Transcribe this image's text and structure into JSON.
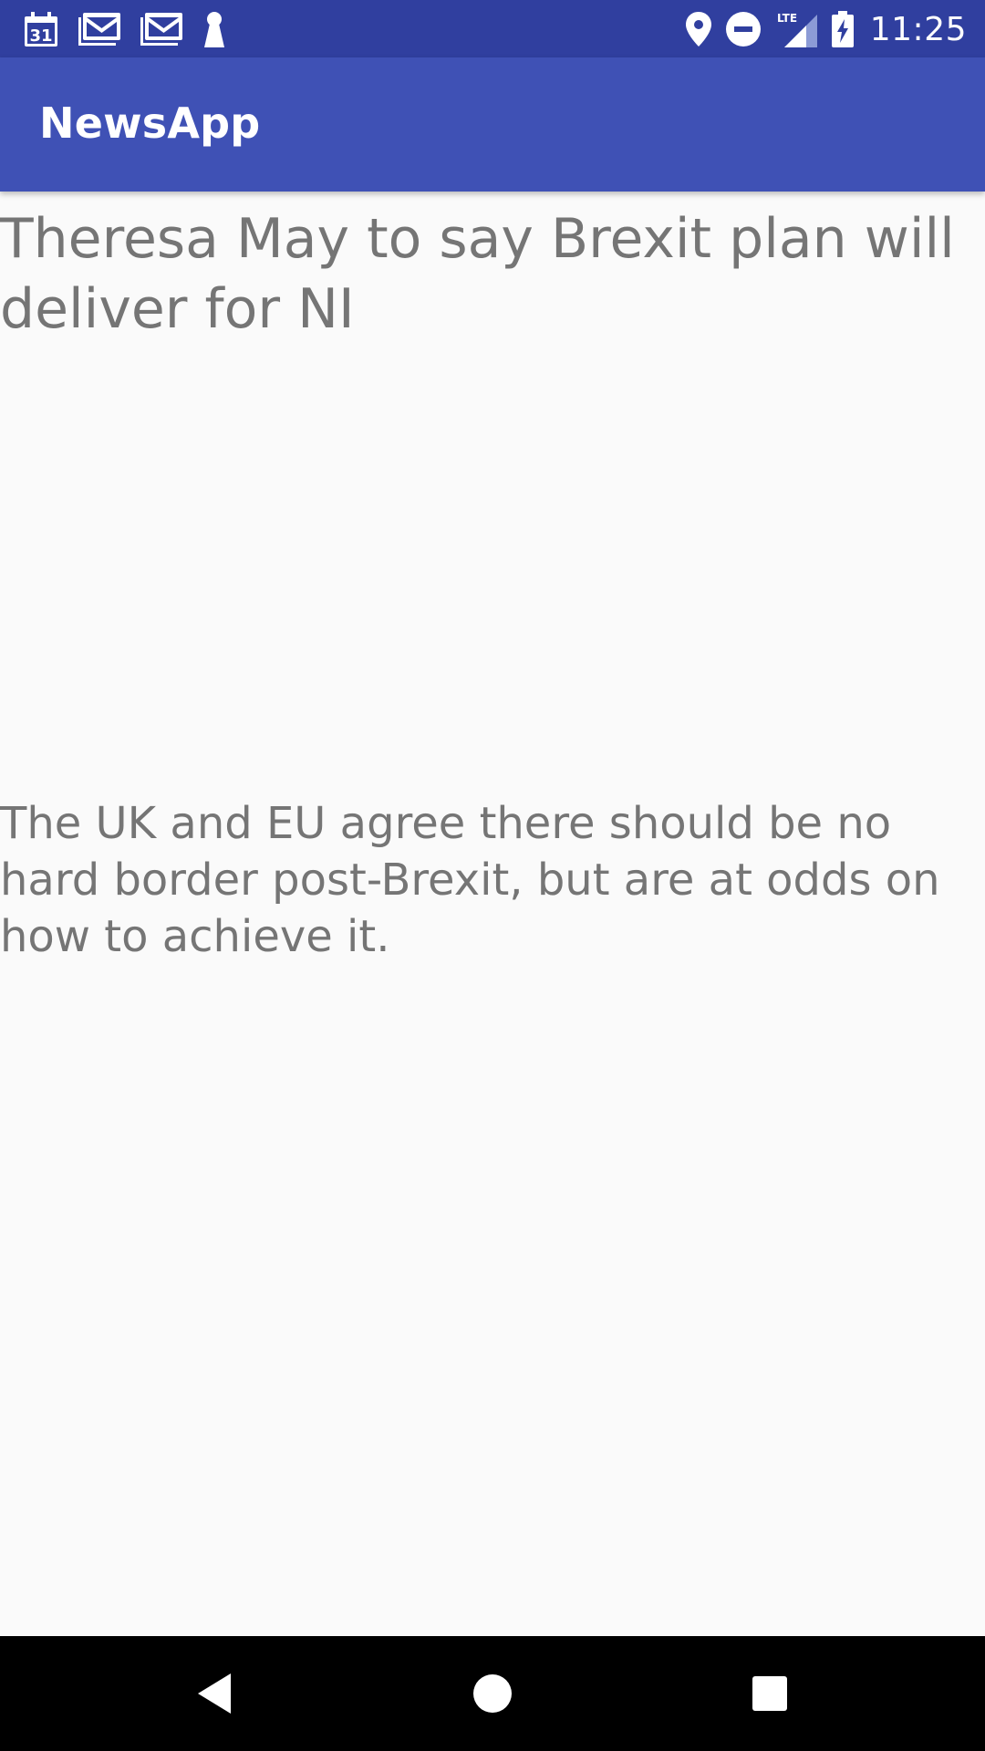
{
  "status_bar": {
    "time": "11:25",
    "calendar_day": "31",
    "network_label": "LTE",
    "left_icons": [
      "calendar-icon",
      "gmail-icon",
      "gmail-icon",
      "keyhole-icon"
    ],
    "right_icons": [
      "location-icon",
      "do-not-disturb-icon",
      "signal-lte-icon",
      "battery-charging-icon"
    ],
    "background_color": "#303f9f"
  },
  "app_bar": {
    "title": "NewsApp",
    "background_color": "#3f51b5"
  },
  "article": {
    "headline": "Theresa May to say Brexit plan will deliver for NI",
    "summary": "The UK and EU agree there should be no hard border post-Brexit, but are at odds on how to achieve it.",
    "text_color": "#757575"
  },
  "nav_bar": {
    "buttons": [
      "back-icon",
      "home-icon",
      "recents-icon"
    ],
    "background_color": "#000000"
  }
}
